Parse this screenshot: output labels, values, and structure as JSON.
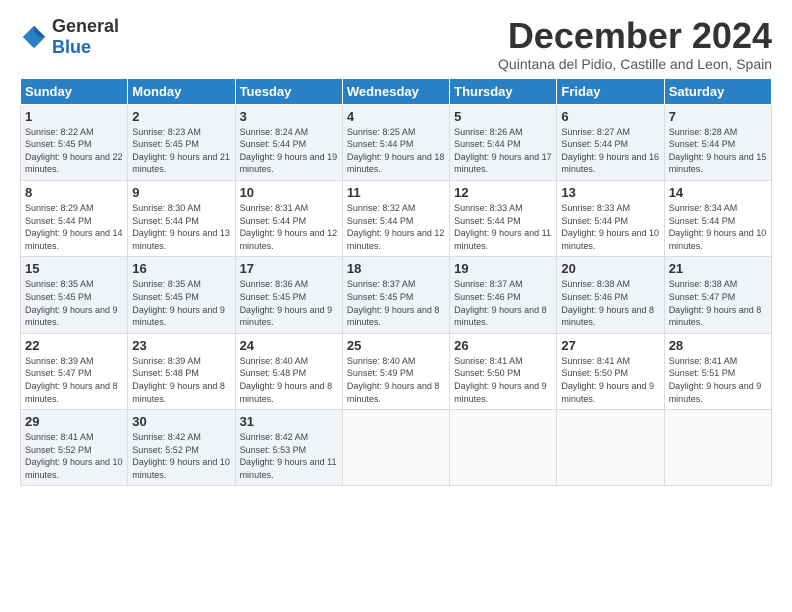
{
  "logo": {
    "general": "General",
    "blue": "Blue"
  },
  "header": {
    "month": "December 2024",
    "location": "Quintana del Pidio, Castille and Leon, Spain"
  },
  "days_of_week": [
    "Sunday",
    "Monday",
    "Tuesday",
    "Wednesday",
    "Thursday",
    "Friday",
    "Saturday"
  ],
  "weeks": [
    [
      {
        "day": "1",
        "sunrise": "8:22 AM",
        "sunset": "5:45 PM",
        "daylight": "9 hours and 22 minutes."
      },
      {
        "day": "2",
        "sunrise": "8:23 AM",
        "sunset": "5:45 PM",
        "daylight": "9 hours and 21 minutes."
      },
      {
        "day": "3",
        "sunrise": "8:24 AM",
        "sunset": "5:44 PM",
        "daylight": "9 hours and 19 minutes."
      },
      {
        "day": "4",
        "sunrise": "8:25 AM",
        "sunset": "5:44 PM",
        "daylight": "9 hours and 18 minutes."
      },
      {
        "day": "5",
        "sunrise": "8:26 AM",
        "sunset": "5:44 PM",
        "daylight": "9 hours and 17 minutes."
      },
      {
        "day": "6",
        "sunrise": "8:27 AM",
        "sunset": "5:44 PM",
        "daylight": "9 hours and 16 minutes."
      },
      {
        "day": "7",
        "sunrise": "8:28 AM",
        "sunset": "5:44 PM",
        "daylight": "9 hours and 15 minutes."
      }
    ],
    [
      {
        "day": "8",
        "sunrise": "8:29 AM",
        "sunset": "5:44 PM",
        "daylight": "9 hours and 14 minutes."
      },
      {
        "day": "9",
        "sunrise": "8:30 AM",
        "sunset": "5:44 PM",
        "daylight": "9 hours and 13 minutes."
      },
      {
        "day": "10",
        "sunrise": "8:31 AM",
        "sunset": "5:44 PM",
        "daylight": "9 hours and 12 minutes."
      },
      {
        "day": "11",
        "sunrise": "8:32 AM",
        "sunset": "5:44 PM",
        "daylight": "9 hours and 12 minutes."
      },
      {
        "day": "12",
        "sunrise": "8:33 AM",
        "sunset": "5:44 PM",
        "daylight": "9 hours and 11 minutes."
      },
      {
        "day": "13",
        "sunrise": "8:33 AM",
        "sunset": "5:44 PM",
        "daylight": "9 hours and 10 minutes."
      },
      {
        "day": "14",
        "sunrise": "8:34 AM",
        "sunset": "5:44 PM",
        "daylight": "9 hours and 10 minutes."
      }
    ],
    [
      {
        "day": "15",
        "sunrise": "8:35 AM",
        "sunset": "5:45 PM",
        "daylight": "9 hours and 9 minutes."
      },
      {
        "day": "16",
        "sunrise": "8:35 AM",
        "sunset": "5:45 PM",
        "daylight": "9 hours and 9 minutes."
      },
      {
        "day": "17",
        "sunrise": "8:36 AM",
        "sunset": "5:45 PM",
        "daylight": "9 hours and 9 minutes."
      },
      {
        "day": "18",
        "sunrise": "8:37 AM",
        "sunset": "5:45 PM",
        "daylight": "9 hours and 8 minutes."
      },
      {
        "day": "19",
        "sunrise": "8:37 AM",
        "sunset": "5:46 PM",
        "daylight": "9 hours and 8 minutes."
      },
      {
        "day": "20",
        "sunrise": "8:38 AM",
        "sunset": "5:46 PM",
        "daylight": "9 hours and 8 minutes."
      },
      {
        "day": "21",
        "sunrise": "8:38 AM",
        "sunset": "5:47 PM",
        "daylight": "9 hours and 8 minutes."
      }
    ],
    [
      {
        "day": "22",
        "sunrise": "8:39 AM",
        "sunset": "5:47 PM",
        "daylight": "9 hours and 8 minutes."
      },
      {
        "day": "23",
        "sunrise": "8:39 AM",
        "sunset": "5:48 PM",
        "daylight": "9 hours and 8 minutes."
      },
      {
        "day": "24",
        "sunrise": "8:40 AM",
        "sunset": "5:48 PM",
        "daylight": "9 hours and 8 minutes."
      },
      {
        "day": "25",
        "sunrise": "8:40 AM",
        "sunset": "5:49 PM",
        "daylight": "9 hours and 8 minutes."
      },
      {
        "day": "26",
        "sunrise": "8:41 AM",
        "sunset": "5:50 PM",
        "daylight": "9 hours and 9 minutes."
      },
      {
        "day": "27",
        "sunrise": "8:41 AM",
        "sunset": "5:50 PM",
        "daylight": "9 hours and 9 minutes."
      },
      {
        "day": "28",
        "sunrise": "8:41 AM",
        "sunset": "5:51 PM",
        "daylight": "9 hours and 9 minutes."
      }
    ],
    [
      {
        "day": "29",
        "sunrise": "8:41 AM",
        "sunset": "5:52 PM",
        "daylight": "9 hours and 10 minutes."
      },
      {
        "day": "30",
        "sunrise": "8:42 AM",
        "sunset": "5:52 PM",
        "daylight": "9 hours and 10 minutes."
      },
      {
        "day": "31",
        "sunrise": "8:42 AM",
        "sunset": "5:53 PM",
        "daylight": "9 hours and 11 minutes."
      },
      null,
      null,
      null,
      null
    ]
  ]
}
